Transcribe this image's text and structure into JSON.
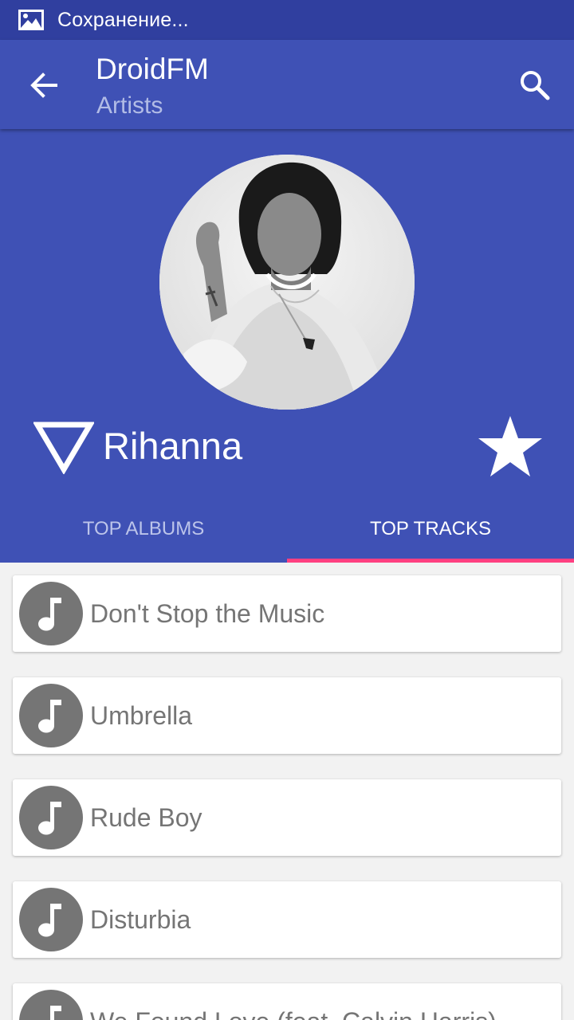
{
  "status_bar": {
    "icon": "image-icon",
    "text": "Сохранение..."
  },
  "app_bar": {
    "back_icon": "arrow-back-icon",
    "title": "DroidFM",
    "subtitle": "Artists",
    "search_icon": "search-icon"
  },
  "artist": {
    "photo": "artist-photo",
    "play_icon": "triangle-down-icon",
    "name": "Rihanna",
    "favorite_icon": "star-icon"
  },
  "tabs": [
    {
      "label": "TOP ALBUMS",
      "active": false
    },
    {
      "label": "TOP TRACKS",
      "active": true
    }
  ],
  "tracks": [
    {
      "title": "Don't Stop the Music",
      "icon": "music-note-icon"
    },
    {
      "title": "Umbrella",
      "icon": "music-note-icon"
    },
    {
      "title": "Rude Boy",
      "icon": "music-note-icon"
    },
    {
      "title": "Disturbia",
      "icon": "music-note-icon"
    },
    {
      "title": "We Found Love (feat. Calvin Harris)",
      "icon": "music-note-icon"
    }
  ],
  "colors": {
    "primary": "#3f51b5",
    "primary_dark": "#303f9f",
    "accent": "#ff4081",
    "icon_gray": "#757575"
  }
}
